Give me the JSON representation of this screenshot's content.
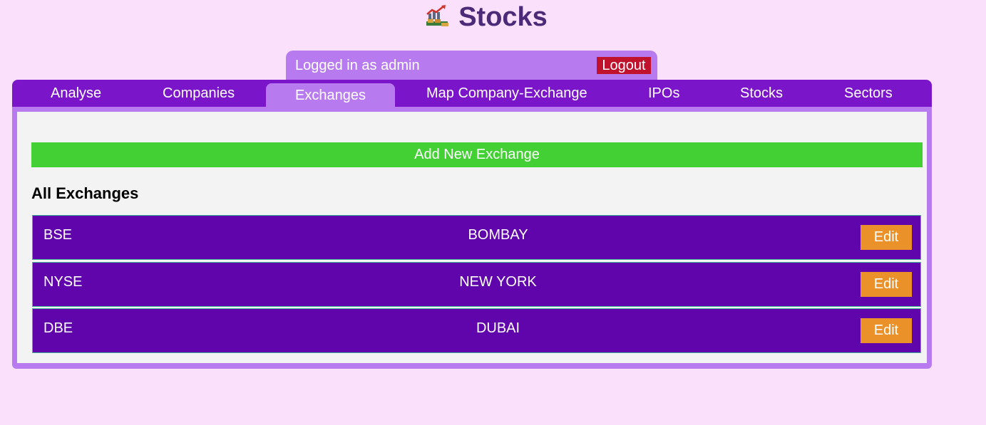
{
  "app": {
    "title": "Stocks",
    "logo_icon": "stock-chart-icon"
  },
  "user": {
    "logged_in_text": "Logged in as admin",
    "logout_label": "Logout"
  },
  "nav": {
    "tabs": [
      {
        "label": "Analyse"
      },
      {
        "label": "Companies"
      },
      {
        "label": "Exchanges",
        "active": true
      },
      {
        "label": "Map Company-Exchange"
      },
      {
        "label": "IPOs"
      },
      {
        "label": "Stocks"
      },
      {
        "label": "Sectors"
      }
    ]
  },
  "main": {
    "add_button_label": "Add New Exchange",
    "section_title": "All Exchanges",
    "edit_label": "Edit",
    "exchanges": [
      {
        "code": "BSE",
        "city": "BOMBAY"
      },
      {
        "code": "NYSE",
        "city": "NEW YORK"
      },
      {
        "code": "DBE",
        "city": "DUBAI"
      }
    ]
  },
  "colors": {
    "background": "#fbe0fb",
    "nav": "#7b15c9",
    "accent_light": "#b87bef",
    "row": "#6004ab",
    "add_button": "#42d034",
    "edit_button": "#ea9129",
    "logout": "#c0122c",
    "title": "#4b2a78"
  }
}
